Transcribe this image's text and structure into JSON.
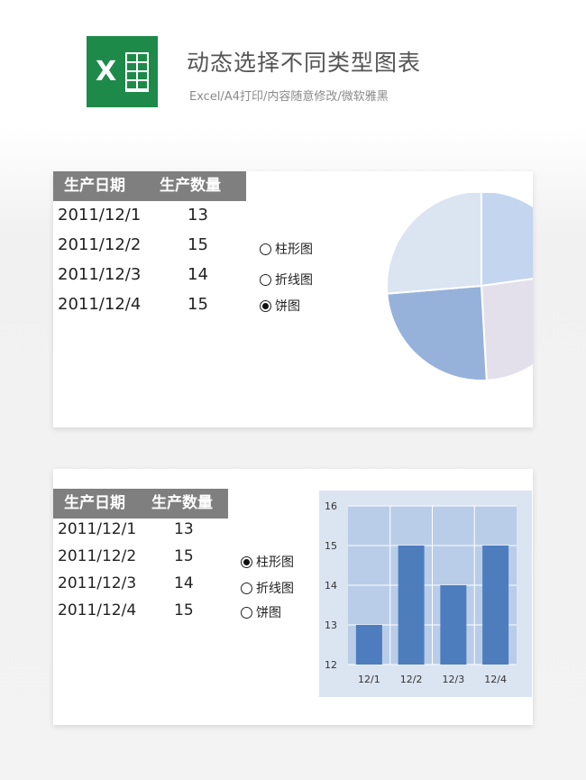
{
  "header": {
    "title": "动态选择不同类型图表",
    "subtitle": "Excel/A4打印/内容随意修改/微软雅黑",
    "logo_letter": "X",
    "logo_color": "#1e8a4a"
  },
  "table": {
    "headers": [
      "生产日期",
      "生产数量"
    ],
    "rows": [
      {
        "date": "2011/12/1",
        "qty": "13"
      },
      {
        "date": "2011/12/2",
        "qty": "15"
      },
      {
        "date": "2011/12/3",
        "qty": "14"
      },
      {
        "date": "2011/12/4",
        "qty": "15"
      }
    ]
  },
  "options": [
    "柱形图",
    "折线图",
    "饼图"
  ],
  "panel1": {
    "selected": "饼图"
  },
  "panel2": {
    "selected": "柱形图"
  },
  "chart_data": [
    {
      "type": "pie",
      "categories": [
        "2011/12/1",
        "2011/12/2",
        "2011/12/3",
        "2011/12/4"
      ],
      "values": [
        13,
        15,
        14,
        15
      ],
      "colors": [
        "#c3d5ef",
        "#e3e0ec",
        "#97b2da",
        "#dbe4f1"
      ],
      "title": "",
      "legend": "none"
    },
    {
      "type": "bar",
      "categories": [
        "12/1",
        "12/2",
        "12/3",
        "12/4"
      ],
      "values": [
        13,
        15,
        14,
        15
      ],
      "ylim": [
        12,
        16
      ],
      "yticks": [
        "12",
        "13",
        "14",
        "15",
        "16"
      ],
      "grid": true,
      "bar_color": "#4e7dbe",
      "plot_bg": "#b9cde8",
      "title": "",
      "xlabel": "",
      "ylabel": ""
    }
  ]
}
